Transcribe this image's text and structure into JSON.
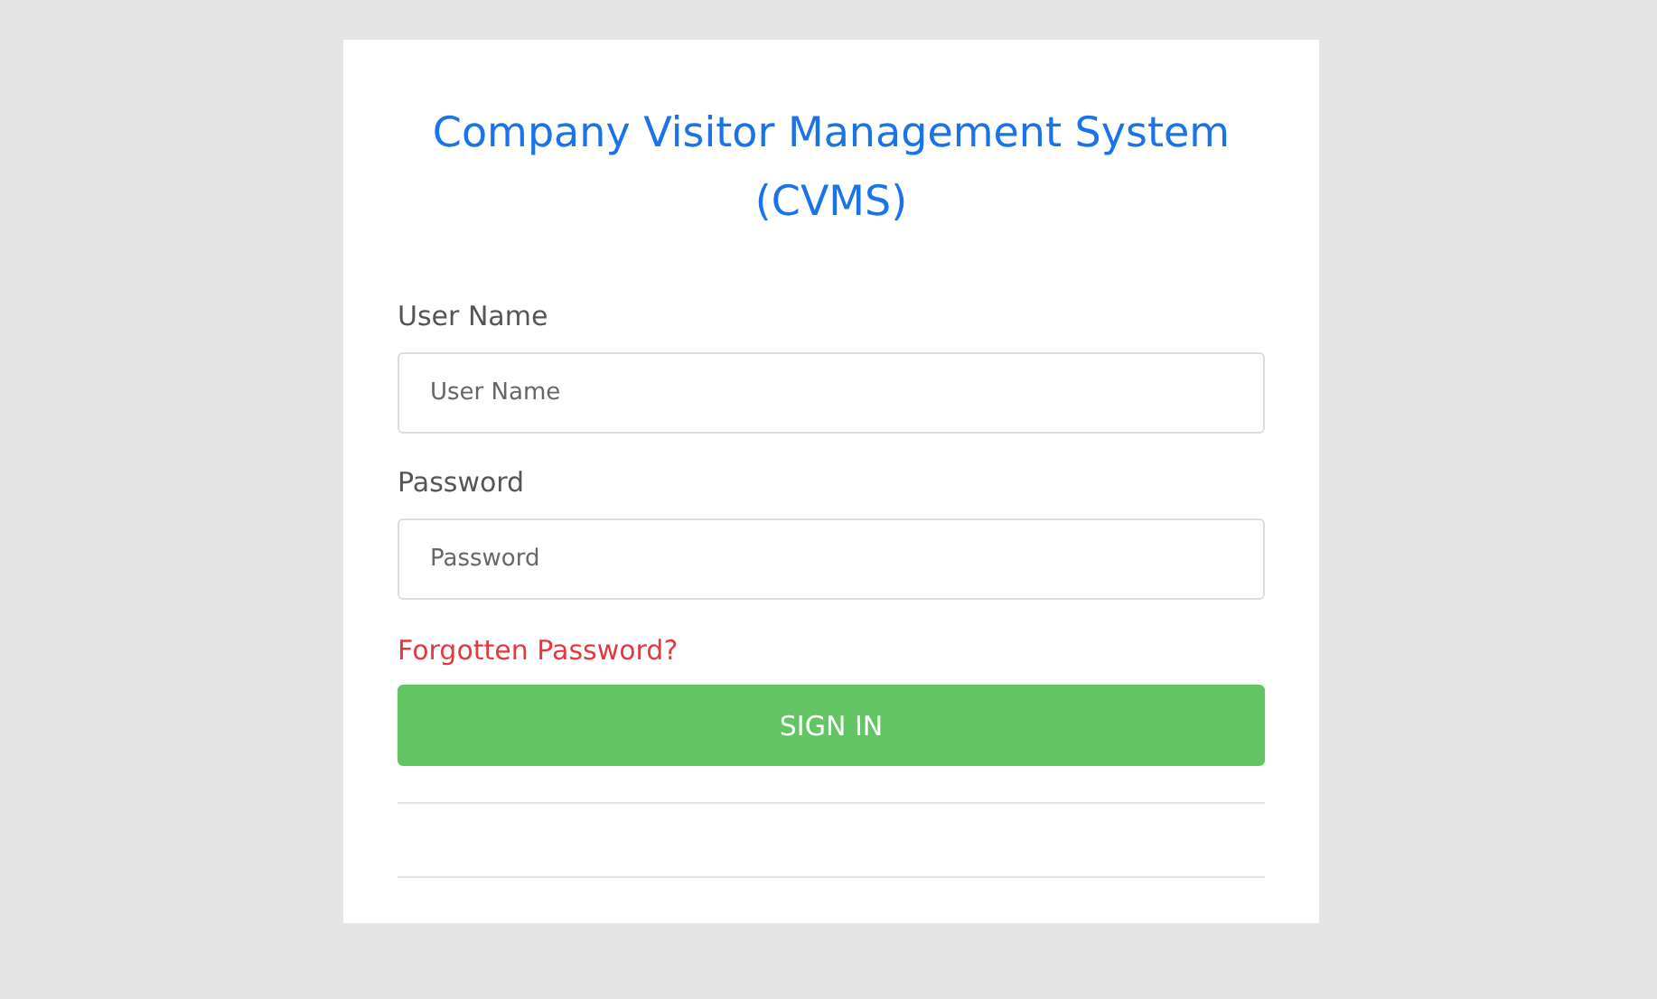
{
  "title": "Company Visitor Management System (CVMS)",
  "fields": [
    {
      "label": "User Name",
      "placeholder": "User Name"
    },
    {
      "label": "Password",
      "placeholder": "Password"
    }
  ],
  "forgot_link": "Forgotten Password?",
  "button": "SIGN IN"
}
